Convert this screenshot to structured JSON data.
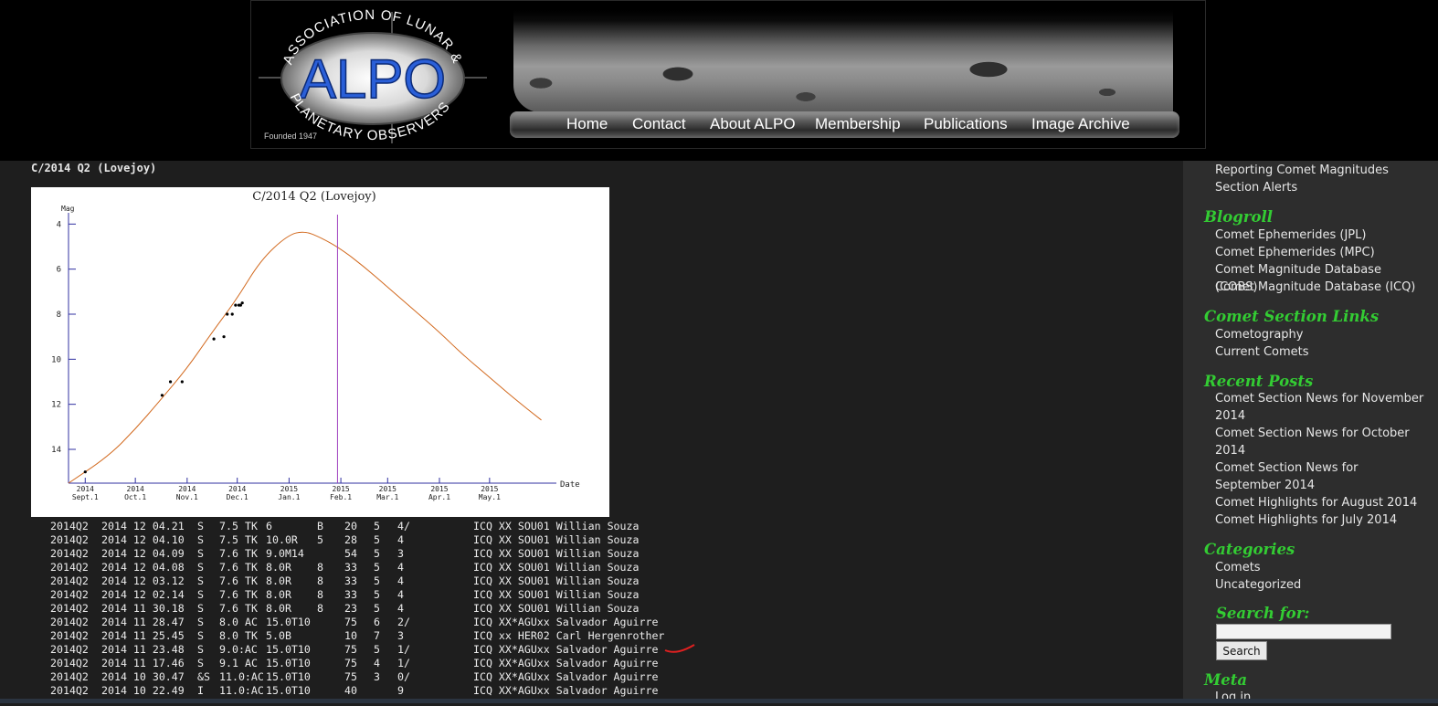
{
  "header": {
    "logo": {
      "top_text": "ASSOCIATION OF LUNAR &",
      "main_text": "ALPO",
      "bottom_text": "PLANETARY OBSERVERS",
      "founded": "Founded 1947"
    },
    "nav": [
      "Home",
      "Contact",
      "About ALPO",
      "Membership",
      "Publications",
      "Image Archive"
    ]
  },
  "post": {
    "title": "C/2014 Q2 (Lovejoy)"
  },
  "chart_data": {
    "type": "line",
    "title": "C/2014 Q2 (Lovejoy)",
    "ylabel": "Mag",
    "xlabel": "Date",
    "y_inverted": true,
    "ylim": [
      15.5,
      3.5
    ],
    "yticks": [
      4,
      6,
      8,
      10,
      12,
      14
    ],
    "xlim": [
      "2014-08-22",
      "2015-06-10"
    ],
    "xticks": [
      {
        "date": "2014-09-01",
        "year": "2014",
        "label": "Sept.1"
      },
      {
        "date": "2014-10-01",
        "year": "2014",
        "label": "Oct.1"
      },
      {
        "date": "2014-11-01",
        "year": "2014",
        "label": "Nov.1"
      },
      {
        "date": "2014-12-01",
        "year": "2014",
        "label": "Dec.1"
      },
      {
        "date": "2015-01-01",
        "year": "2015",
        "label": "Jan.1"
      },
      {
        "date": "2015-02-01",
        "year": "2015",
        "label": "Feb.1"
      },
      {
        "date": "2015-03-01",
        "year": "2015",
        "label": "Mar.1"
      },
      {
        "date": "2015-04-01",
        "year": "2015",
        "label": "Apr.1"
      },
      {
        "date": "2015-05-01",
        "year": "2015",
        "label": "May.1"
      }
    ],
    "model_curve": {
      "color": "#d2691e",
      "points": [
        [
          "2014-08-22",
          15.7
        ],
        [
          "2014-09-15",
          14.3
        ],
        [
          "2014-10-01",
          13.1
        ],
        [
          "2014-10-15",
          11.9
        ],
        [
          "2014-11-01",
          10.4
        ],
        [
          "2014-11-15",
          8.9
        ],
        [
          "2014-12-01",
          7.3
        ],
        [
          "2014-12-15",
          5.6
        ],
        [
          "2014-12-31",
          4.5
        ],
        [
          "2015-01-10",
          4.3
        ],
        [
          "2015-01-20",
          4.6
        ],
        [
          "2015-02-01",
          5.1
        ],
        [
          "2015-02-15",
          5.9
        ],
        [
          "2015-03-01",
          6.8
        ],
        [
          "2015-03-15",
          7.7
        ],
        [
          "2015-04-01",
          8.8
        ],
        [
          "2015-04-15",
          9.8
        ],
        [
          "2015-05-01",
          10.8
        ],
        [
          "2015-05-15",
          11.7
        ],
        [
          "2015-06-01",
          12.7
        ]
      ]
    },
    "marker_line": {
      "date": "2015-01-30",
      "color": "#a040c0"
    },
    "observations": [
      [
        "2014-09-01",
        15.0
      ],
      [
        "2014-10-17",
        11.6
      ],
      [
        "2014-10-22",
        11.0
      ],
      [
        "2014-10-29",
        11.0
      ],
      [
        "2014-11-17",
        9.1
      ],
      [
        "2014-11-23",
        9.0
      ],
      [
        "2014-11-25",
        8.0
      ],
      [
        "2014-11-28",
        8.0
      ],
      [
        "2014-11-30",
        7.6
      ],
      [
        "2014-12-02",
        7.6
      ],
      [
        "2014-12-03",
        7.6
      ],
      [
        "2014-12-04",
        7.5
      ]
    ]
  },
  "observations": [
    [
      "2014Q2",
      "2014 12 04.21",
      "S",
      "7.5",
      "TK",
      "6",
      "B",
      "20",
      "5",
      "4/",
      "ICQ XX SOU01 Willian Souza"
    ],
    [
      "2014Q2",
      "2014 12 04.10",
      "S",
      "7.5",
      "TK",
      "10.0R",
      "5",
      "28",
      "5",
      "4",
      "ICQ XX SOU01 Willian Souza"
    ],
    [
      "2014Q2",
      "2014 12 04.09",
      "S",
      "7.6",
      "TK",
      "9.0M14",
      "",
      "54",
      "5",
      "3",
      "ICQ XX SOU01 Willian Souza"
    ],
    [
      "2014Q2",
      "2014 12 04.08",
      "S",
      "7.6",
      "TK",
      "8.0R",
      "8",
      "33",
      "5",
      "4",
      "ICQ XX SOU01 Willian Souza"
    ],
    [
      "2014Q2",
      "2014 12 03.12",
      "S",
      "7.6",
      "TK",
      "8.0R",
      "8",
      "33",
      "5",
      "4",
      "ICQ XX SOU01 Willian Souza"
    ],
    [
      "2014Q2",
      "2014 12 02.14",
      "S",
      "7.6",
      "TK",
      "8.0R",
      "8",
      "33",
      "5",
      "4",
      "ICQ XX SOU01 Willian Souza"
    ],
    [
      "2014Q2",
      "2014 11 30.18",
      "S",
      "7.6",
      "TK",
      "8.0R",
      "8",
      "23",
      "5",
      "4",
      "ICQ XX SOU01 Willian Souza"
    ],
    [
      "2014Q2",
      "2014 11 28.47",
      "S",
      "8.0",
      "AC",
      "15.0T10",
      "",
      "75",
      "6",
      "2/",
      "ICQ XX*AGUxx Salvador Aguirre"
    ],
    [
      "2014Q2",
      "2014 11 25.45",
      "S",
      "8.0",
      "TK",
      "5.0B",
      "",
      "10",
      "7",
      "3",
      "ICQ xx HER02 Carl Hergenrother"
    ],
    [
      "2014Q2",
      "2014 11 23.48",
      "S",
      "9.0:AC",
      "",
      "15.0T10",
      "",
      "75",
      "5",
      "1/",
      "ICQ XX*AGUxx Salvador Aguirre"
    ],
    [
      "2014Q2",
      "2014 11 17.46",
      "S",
      "9.1",
      "AC",
      "15.0T10",
      "",
      "75",
      "4",
      "1/",
      "ICQ XX*AGUxx Salvador Aguirre"
    ],
    [
      "2014Q2",
      "2014 10 30.47",
      "&S",
      "11.0:AC",
      "",
      "15.0T10",
      "",
      "75",
      "3",
      "0/",
      "ICQ XX*AGUxx Salvador Aguirre"
    ],
    [
      "2014Q2",
      "2014 10 22.49",
      "I",
      "11.0:AC",
      "",
      "15.0T10",
      "",
      "40",
      "",
      "9",
      "ICQ XX*AGUxx Salvador Aguirre"
    ]
  ],
  "sidebar": {
    "top_links": [
      "Reporting Comet Magnitudes",
      "Section Alerts"
    ],
    "blogroll": {
      "heading": "Blogroll",
      "links": [
        "Comet Ephemerides (JPL)",
        "Comet Ephemerides (MPC)",
        "Comet Magnitude Database (COBS)",
        "Comet Magnitude Database (ICQ)"
      ]
    },
    "comet_links": {
      "heading": "Comet Section Links",
      "links": [
        "Cometography",
        "Current Comets"
      ]
    },
    "recent_posts": {
      "heading": "Recent Posts",
      "links": [
        "Comet Section News for November 2014",
        "Comet Section News for October 2014",
        "Comet Section News for September 2014",
        "Comet Highlights for August 2014",
        "Comet Highlights for July 2014"
      ]
    },
    "categories": {
      "heading": "Categories",
      "links": [
        "Comets",
        "Uncategorized"
      ]
    },
    "search": {
      "heading": "Search for:",
      "value": "",
      "button": "Search"
    },
    "meta": {
      "heading": "Meta",
      "links": [
        "Log in"
      ]
    }
  },
  "colors": {
    "page_bg": "#1e1e1e",
    "sidebar_bg": "#2d2d2d",
    "heading_green": "#33cc33",
    "logo_blue": "#2a5fd8"
  }
}
